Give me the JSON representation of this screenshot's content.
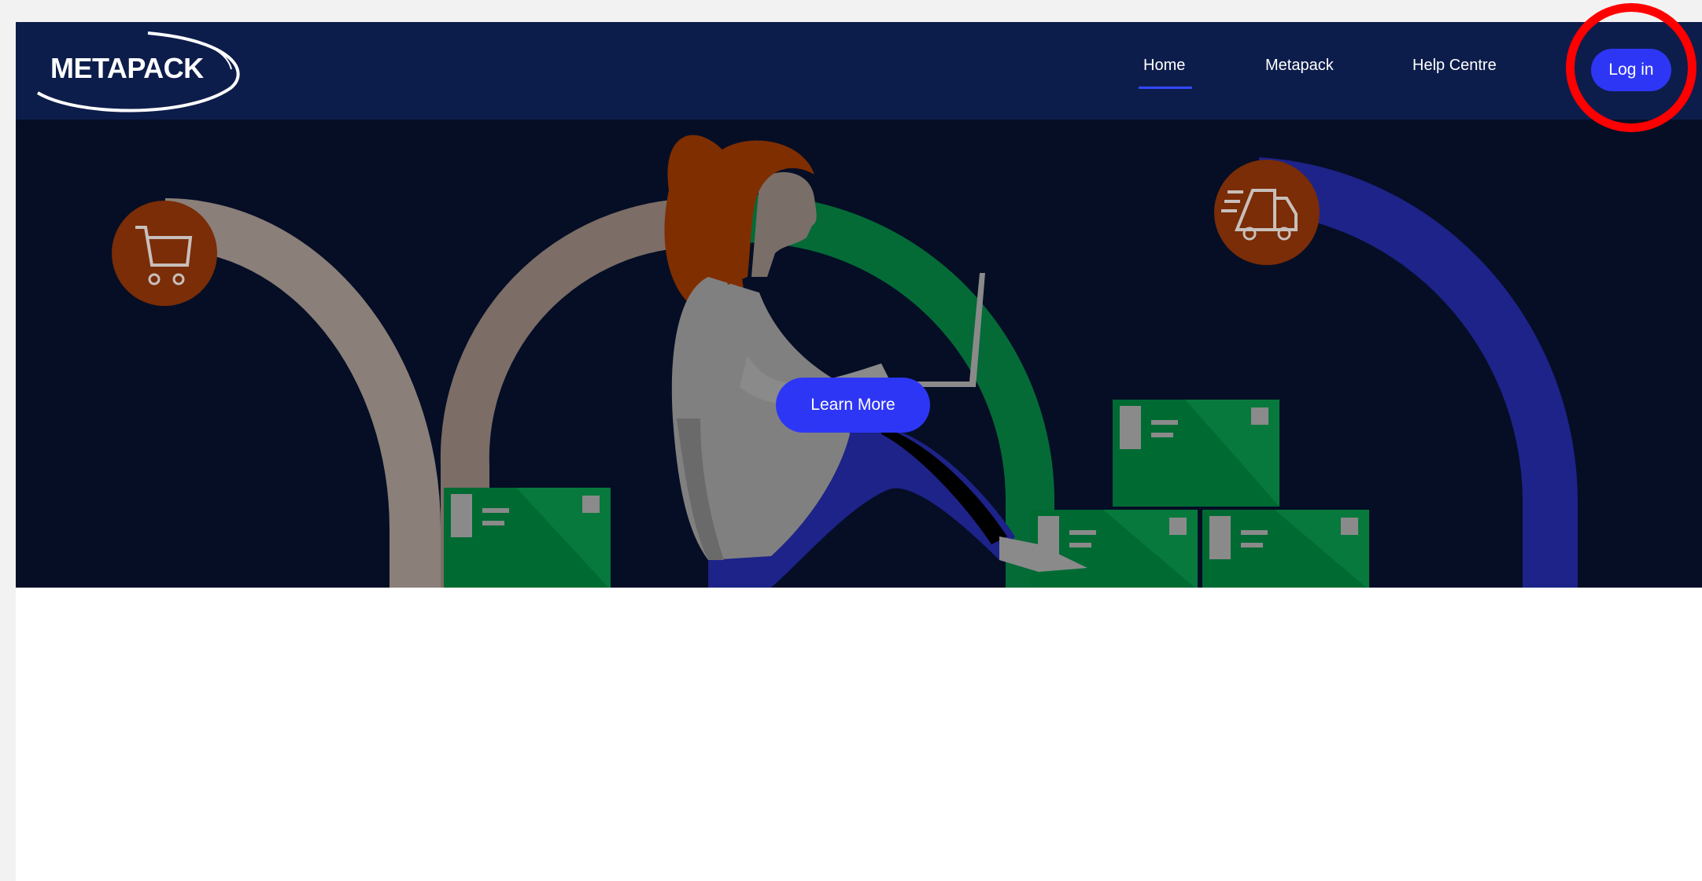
{
  "header": {
    "logo_text": "METAPACK",
    "nav": {
      "home": "Home",
      "metapack": "Metapack",
      "help_centre": "Help Centre"
    },
    "login_label": "Log in"
  },
  "hero": {
    "cta_label": "Learn More"
  },
  "colors": {
    "nav_background": "#0d1d4b",
    "hero_background": "#050e25",
    "accent_button": "#2e36f5",
    "highlight_ring": "#ff0000"
  },
  "icons": [
    "shopping-cart-icon",
    "delivery-truck-icon"
  ]
}
